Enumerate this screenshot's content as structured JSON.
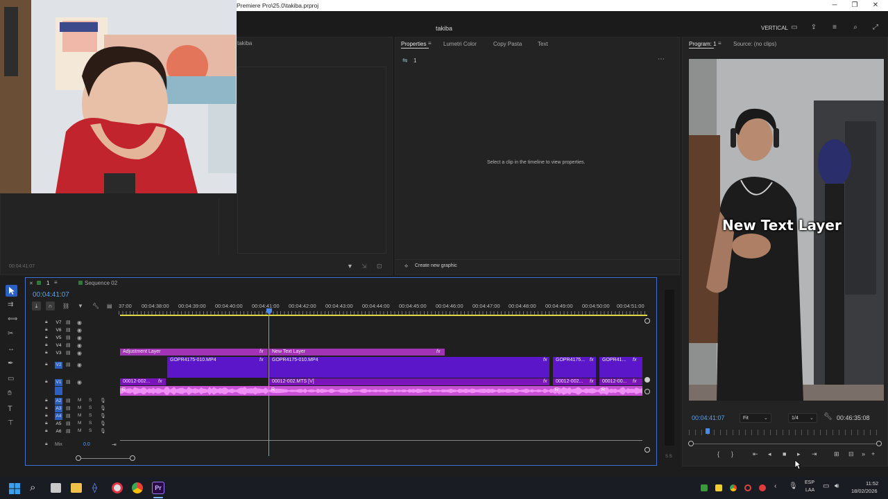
{
  "window": {
    "title": "Premiere Pro\\25.0\\takiba.prproj",
    "minimize": "─",
    "maximize": "❐",
    "close": "✕"
  },
  "workspace": {
    "project_name": "takiba",
    "layout_label": "VERTICAL"
  },
  "left_panel": {
    "tab_fragment": "takiba",
    "timecode": "00:04:41:07"
  },
  "properties": {
    "tabs": [
      "Properties",
      "Lumetri Color",
      "Copy Pasta",
      "Text"
    ],
    "count": "1",
    "empty_message": "Select a clip in the timeline to view properties.",
    "create_graphic": "Create new graphic"
  },
  "program": {
    "tabs": [
      "Program: 1",
      "Source: (no clips)"
    ],
    "caption": "New Text Layer",
    "current_time": "00:04:41:07",
    "fit": "Fit",
    "resolution": "1/4",
    "duration": "00:46:35:08"
  },
  "timeline": {
    "tabs": [
      "1",
      "Sequence 02"
    ],
    "playhead_time": "00:04:41:07",
    "ruler": [
      "37:00",
      "00:04:38:00",
      "00:04:39:00",
      "00:04:40:00",
      "00:04:41:00",
      "00:04:42:00",
      "00:04:43:00",
      "00:04:44:00",
      "00:04:45:00",
      "00:04:46:00",
      "00:04:47:00",
      "00:04:48:00",
      "00:04:49:00",
      "00:04:50:00",
      "00:04:51:00"
    ],
    "video_tracks": [
      "V7",
      "V6",
      "V5",
      "V4",
      "V3",
      "V2",
      "V1"
    ],
    "audio_tracks": [
      "A2",
      "A3",
      "A4",
      "A5",
      "A6"
    ],
    "mix_label": "Mix",
    "mix_value": "0.0",
    "clips": {
      "v3_a": "Adjustment Layer",
      "v3_b": "New Text Layer",
      "v2_a": "GOPR4175-010.MP4",
      "v2_b": "GOPR4175-010.MP4",
      "v2_c": "GOPR4175...",
      "v2_d": "GOPR41...",
      "v1_a": "00012-002...",
      "v1_b": "00012-002.MTS [V]",
      "v1_c": "00012-002...",
      "v1_d": "00012-00...",
      "fx": "fx",
      "r": "R"
    },
    "meter_label": "S S"
  },
  "taskbar": {
    "lang_top": "ESP",
    "lang_bottom": "LAA",
    "time": "11:52",
    "date": "18/02/2026"
  }
}
